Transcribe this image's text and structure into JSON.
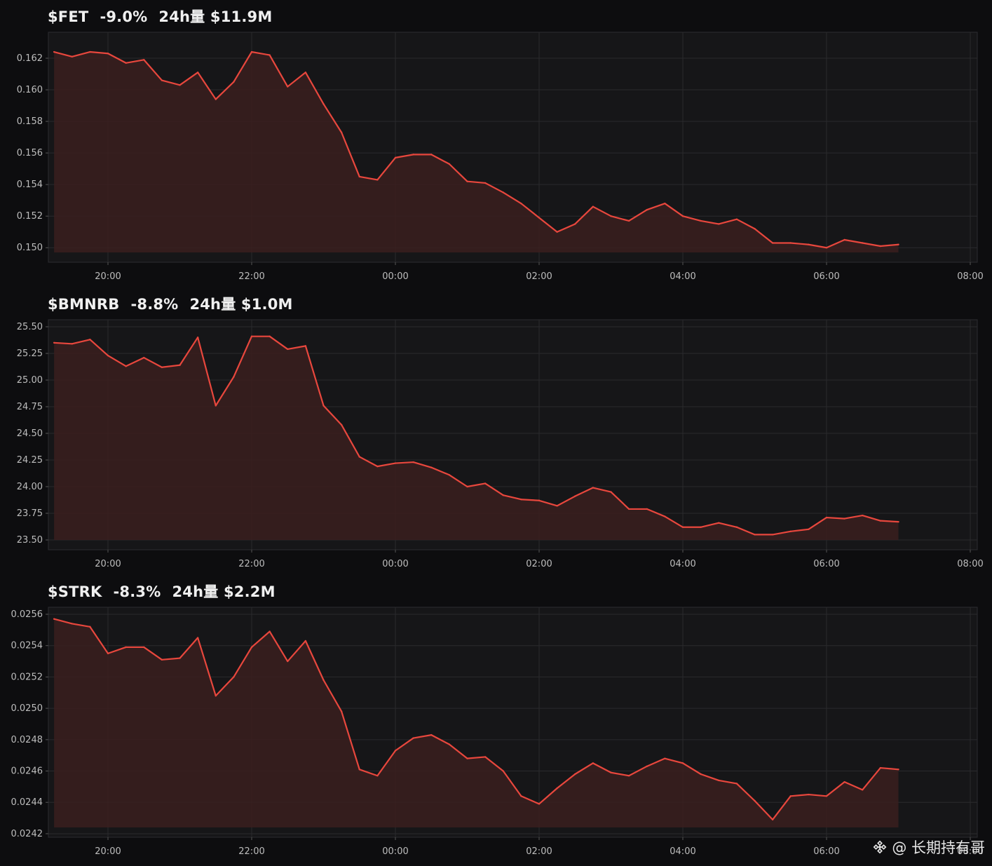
{
  "colors": {
    "background": "#0d0d0f",
    "plot_background": "#161618",
    "line": "#e8473d",
    "fill": "#3a1e1e",
    "grid": "#2a2a2d",
    "axis_text": "#bdbdbd"
  },
  "watermark": {
    "logo": "binance-logo-icon",
    "text": "@ 长期持有哥"
  },
  "chart_data": [
    {
      "type": "area",
      "symbol": "$FET",
      "change": "-9.0%",
      "volume_label": "24h量 $11.9M",
      "x_ticks": [
        "20:00",
        "22:00",
        "00:00",
        "02:00",
        "04:00",
        "06:00",
        "08:00"
      ],
      "x_tick_hours": [
        20,
        22,
        24,
        26,
        28,
        30,
        32
      ],
      "y_ticks": [
        0.15,
        0.152,
        0.154,
        0.156,
        0.158,
        0.16,
        0.162
      ],
      "y_tick_labels": [
        "0.150",
        "0.152",
        "0.154",
        "0.156",
        "0.158",
        "0.160",
        "0.162"
      ],
      "ylim": [
        0.1497,
        0.1632
      ],
      "x_start_hour": 19.25,
      "x_step_hours": 0.25,
      "values": [
        0.1624,
        0.1621,
        0.1624,
        0.1623,
        0.1617,
        0.1619,
        0.1606,
        0.1603,
        0.1611,
        0.1594,
        0.1605,
        0.1624,
        0.1622,
        0.1602,
        0.1611,
        0.1591,
        0.1573,
        0.1545,
        0.1543,
        0.1557,
        0.1559,
        0.1559,
        0.1553,
        0.1542,
        0.1541,
        0.1535,
        0.1528,
        0.1519,
        0.151,
        0.1515,
        0.1526,
        0.152,
        0.1517,
        0.1524,
        0.1528,
        0.152,
        0.1517,
        0.1515,
        0.1518,
        0.1512,
        0.1503,
        0.1503,
        0.1502,
        0.15,
        0.1505,
        0.1503,
        0.1501,
        0.1502
      ]
    },
    {
      "type": "area",
      "symbol": "$BMNRB",
      "change": "-8.8%",
      "volume_label": "24h量 $1.0M",
      "x_ticks": [
        "20:00",
        "22:00",
        "00:00",
        "02:00",
        "04:00",
        "06:00",
        "08:00"
      ],
      "x_tick_hours": [
        20,
        22,
        24,
        26,
        28,
        30,
        32
      ],
      "y_ticks": [
        23.5,
        23.75,
        24.0,
        24.25,
        24.5,
        24.75,
        25.0,
        25.25,
        25.5
      ],
      "y_tick_labels": [
        "23.50",
        "23.75",
        "24.00",
        "24.25",
        "24.50",
        "24.75",
        "25.00",
        "25.25",
        "25.50"
      ],
      "ylim": [
        23.5,
        25.5
      ],
      "x_start_hour": 19.25,
      "x_step_hours": 0.25,
      "values": [
        25.35,
        25.34,
        25.38,
        25.23,
        25.13,
        25.21,
        25.12,
        25.14,
        25.4,
        24.76,
        25.03,
        25.41,
        25.41,
        25.29,
        25.32,
        24.76,
        24.58,
        24.28,
        24.19,
        24.22,
        24.23,
        24.18,
        24.11,
        24.0,
        24.03,
        23.92,
        23.88,
        23.87,
        23.82,
        23.91,
        23.99,
        23.95,
        23.79,
        23.79,
        23.72,
        23.62,
        23.62,
        23.66,
        23.62,
        23.55,
        23.55,
        23.58,
        23.6,
        23.71,
        23.7,
        23.73,
        23.68,
        23.67
      ]
    },
    {
      "type": "area",
      "symbol": "$STRK",
      "change": "-8.3%",
      "volume_label": "24h量 $2.2M",
      "x_ticks": [
        "20:00",
        "22:00",
        "00:00",
        "02:00",
        "04:00",
        "06:00",
        "08:00"
      ],
      "x_tick_hours": [
        20,
        22,
        24,
        26,
        28,
        30,
        32
      ],
      "y_ticks": [
        0.0242,
        0.0244,
        0.0246,
        0.0248,
        0.025,
        0.0252,
        0.0254,
        0.0256
      ],
      "y_tick_labels": [
        "0.0242",
        "0.0244",
        "0.0246",
        "0.0248",
        "0.0250",
        "0.0252",
        "0.0254",
        "0.0256"
      ],
      "ylim": [
        0.02424,
        0.0256
      ],
      "x_start_hour": 19.25,
      "x_step_hours": 0.25,
      "values": [
        0.02557,
        0.02554,
        0.02552,
        0.02535,
        0.02539,
        0.02539,
        0.02531,
        0.02532,
        0.02545,
        0.02508,
        0.0252,
        0.02539,
        0.02549,
        0.0253,
        0.02543,
        0.02518,
        0.02498,
        0.02461,
        0.02457,
        0.02473,
        0.02481,
        0.02483,
        0.02477,
        0.02468,
        0.02469,
        0.0246,
        0.02444,
        0.02439,
        0.02449,
        0.02458,
        0.02465,
        0.02459,
        0.02457,
        0.02463,
        0.02468,
        0.02465,
        0.02458,
        0.02454,
        0.02452,
        0.02441,
        0.02429,
        0.02444,
        0.02445,
        0.02444,
        0.02453,
        0.02448,
        0.02462,
        0.02461
      ]
    }
  ]
}
